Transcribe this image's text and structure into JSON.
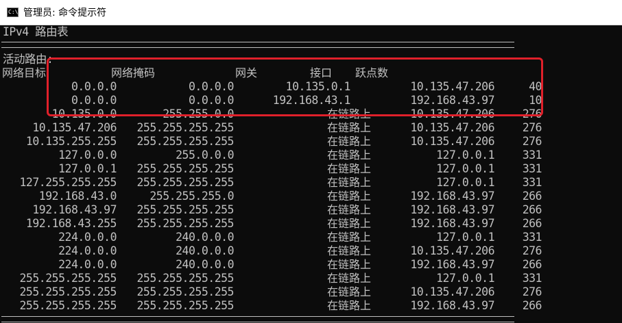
{
  "window": {
    "title": "管理员: 命令提示符",
    "icon": "cmd-icon",
    "icon_glyph": "C:\\"
  },
  "console": {
    "heading": "IPv4 路由表",
    "section": "活动路由:",
    "headers": {
      "destination": "网络目标",
      "netmask": "网络掩码",
      "gateway": "网关",
      "interface": "接口",
      "metric": "跃点数"
    },
    "routes": [
      {
        "destination": "0.0.0.0",
        "netmask": "0.0.0.0",
        "gateway": "10.135.0.1",
        "interface": "10.135.47.206",
        "metric": "40"
      },
      {
        "destination": "0.0.0.0",
        "netmask": "0.0.0.0",
        "gateway": "192.168.43.1",
        "interface": "192.168.43.97",
        "metric": "10"
      },
      {
        "destination": "10.135.0.0",
        "netmask": "255.255.0.0",
        "gateway": "在链路上",
        "interface": "10.135.47.206",
        "metric": "276"
      },
      {
        "destination": "10.135.47.206",
        "netmask": "255.255.255.255",
        "gateway": "在链路上",
        "interface": "10.135.47.206",
        "metric": "276"
      },
      {
        "destination": "10.135.255.255",
        "netmask": "255.255.255.255",
        "gateway": "在链路上",
        "interface": "10.135.47.206",
        "metric": "276"
      },
      {
        "destination": "127.0.0.0",
        "netmask": "255.0.0.0",
        "gateway": "在链路上",
        "interface": "127.0.0.1",
        "metric": "331"
      },
      {
        "destination": "127.0.0.1",
        "netmask": "255.255.255.255",
        "gateway": "在链路上",
        "interface": "127.0.0.1",
        "metric": "331"
      },
      {
        "destination": "127.255.255.255",
        "netmask": "255.255.255.255",
        "gateway": "在链路上",
        "interface": "127.0.0.1",
        "metric": "331"
      },
      {
        "destination": "192.168.43.0",
        "netmask": "255.255.255.0",
        "gateway": "在链路上",
        "interface": "192.168.43.97",
        "metric": "266"
      },
      {
        "destination": "192.168.43.97",
        "netmask": "255.255.255.255",
        "gateway": "在链路上",
        "interface": "192.168.43.97",
        "metric": "266"
      },
      {
        "destination": "192.168.43.255",
        "netmask": "255.255.255.255",
        "gateway": "在链路上",
        "interface": "192.168.43.97",
        "metric": "266"
      },
      {
        "destination": "224.0.0.0",
        "netmask": "240.0.0.0",
        "gateway": "在链路上",
        "interface": "127.0.0.1",
        "metric": "331"
      },
      {
        "destination": "224.0.0.0",
        "netmask": "240.0.0.0",
        "gateway": "在链路上",
        "interface": "10.135.47.206",
        "metric": "276"
      },
      {
        "destination": "224.0.0.0",
        "netmask": "240.0.0.0",
        "gateway": "在链路上",
        "interface": "192.168.43.97",
        "metric": "266"
      },
      {
        "destination": "255.255.255.255",
        "netmask": "255.255.255.255",
        "gateway": "在链路上",
        "interface": "127.0.0.1",
        "metric": "331"
      },
      {
        "destination": "255.255.255.255",
        "netmask": "255.255.255.255",
        "gateway": "在链路上",
        "interface": "10.135.47.206",
        "metric": "276"
      },
      {
        "destination": "255.255.255.255",
        "netmask": "255.255.255.255",
        "gateway": "在链路上",
        "interface": "192.168.43.97",
        "metric": "266"
      }
    ]
  },
  "annotation": {
    "color": "#e0202a"
  }
}
